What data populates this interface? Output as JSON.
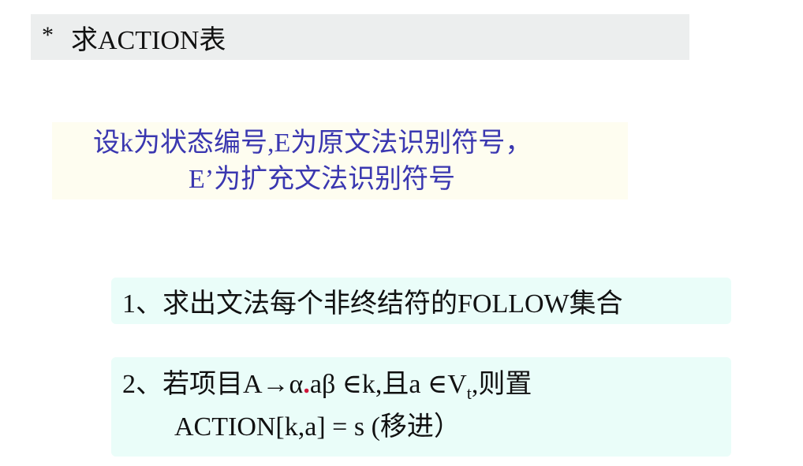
{
  "title": {
    "bullet": "*",
    "text": "求ACTION表"
  },
  "definition": {
    "line1": "设k为状态编号,E为原文法识别符号，",
    "line2": "E’为扩充文法识别符号"
  },
  "step1": {
    "text": "1、求出文法每个非终结符的FOLLOW集合"
  },
  "step2": {
    "prefix": "2、若项目A→α",
    "dot": ".",
    "after_dot": "aβ ∈k,且a ∈V",
    "subscript": "t",
    "suffix": ",则置",
    "line2": "ACTION[k,a] = s (移进）"
  },
  "colors": {
    "title_bg": "#eceeee",
    "definition_bg": "#fefdf0",
    "definition_text": "#3a37b0",
    "step_bg": "#eafdf9",
    "dot": "#d0163a"
  }
}
